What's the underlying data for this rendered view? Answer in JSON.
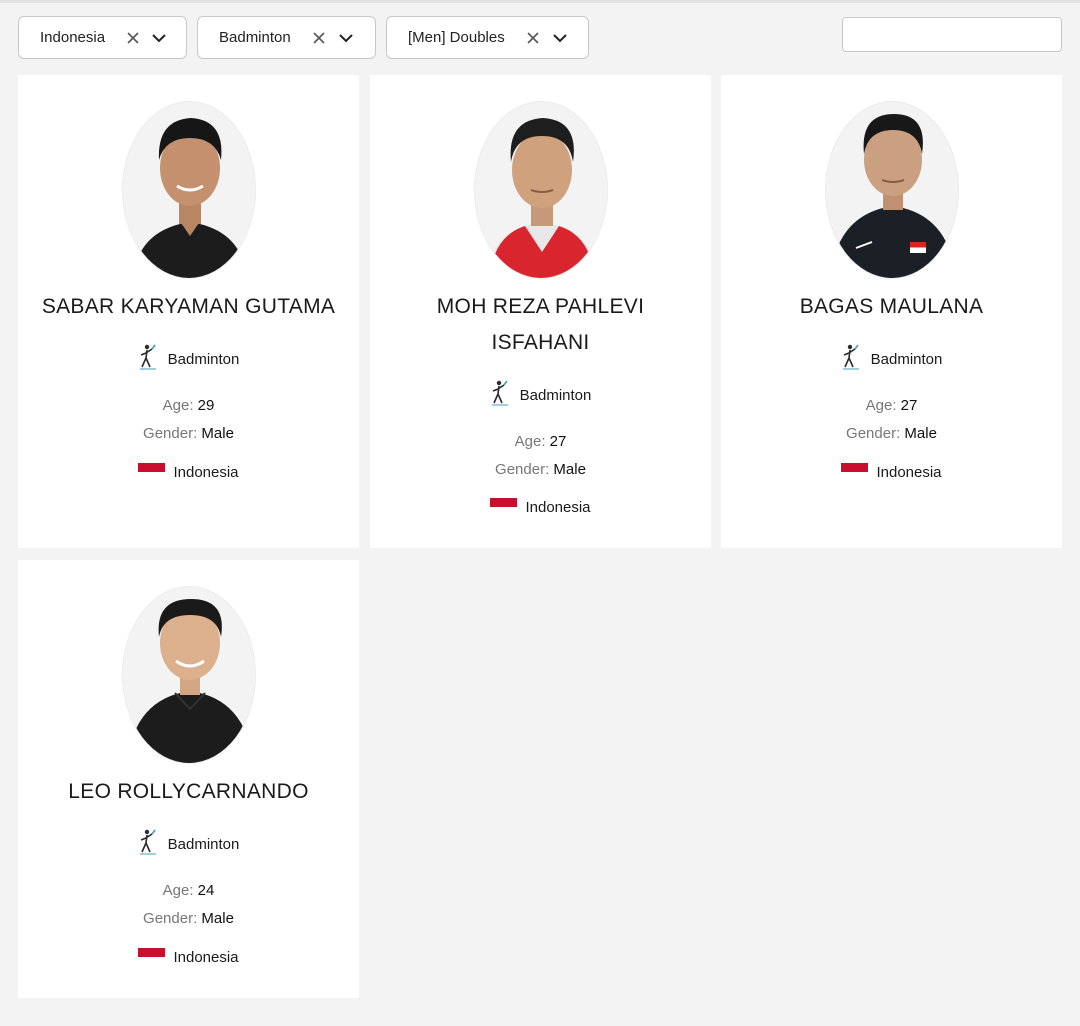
{
  "filters": [
    {
      "label": "Indonesia"
    },
    {
      "label": "Badminton"
    },
    {
      "label": "[Men] Doubles"
    }
  ],
  "search": {
    "value": "",
    "placeholder": ""
  },
  "labels": {
    "age": "Age:",
    "gender": "Gender:"
  },
  "colors": {
    "flag_red": "#c8102e",
    "card_bg": "#ffffff",
    "page_bg": "#f3f3f3"
  },
  "athletes": [
    {
      "name_lines": [
        "SABAR KARYAMAN GUTAMA"
      ],
      "sport": "Badminton",
      "age": "29",
      "gender": "Male",
      "country": "Indonesia",
      "shirt": "black"
    },
    {
      "name_lines": [
        "MOH REZA PAHLEVI",
        "ISFAHANI"
      ],
      "sport": "Badminton",
      "age": "27",
      "gender": "Male",
      "country": "Indonesia",
      "shirt": "red"
    },
    {
      "name_lines": [
        "BAGAS MAULANA"
      ],
      "sport": "Badminton",
      "age": "27",
      "gender": "Male",
      "country": "Indonesia",
      "shirt": "black-jersey"
    },
    {
      "name_lines": [
        "LEO ROLLYCARNANDO"
      ],
      "sport": "Badminton",
      "age": "24",
      "gender": "Male",
      "country": "Indonesia",
      "shirt": "black"
    }
  ]
}
